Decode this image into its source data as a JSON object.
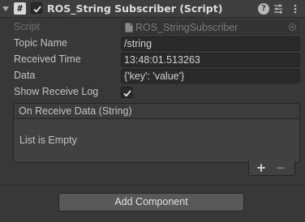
{
  "component": {
    "title": "ROS_String Subscriber (Script)",
    "script_icon_glyph": "#",
    "help_glyph": "?",
    "enabled": true
  },
  "fields": {
    "script": {
      "label": "Script",
      "value": "ROS_StringSubscriber"
    },
    "topic_name": {
      "label": "Topic Name",
      "value": "/string"
    },
    "received_time": {
      "label": "Received Time",
      "value": "13:48:01.513263"
    },
    "data": {
      "label": "Data",
      "value": "{'key': 'value'}"
    },
    "show_receive_log": {
      "label": "Show Receive Log",
      "checked": true
    }
  },
  "event": {
    "title": "On Receive Data (String)",
    "empty_text": "List is Empty",
    "add_glyph": "+",
    "remove_glyph": "−"
  },
  "footer": {
    "add_component_label": "Add Component"
  },
  "icons": {
    "foldout": "foldout-arrow-icon",
    "script": "csharp-script-icon",
    "help": "help-icon",
    "preset": "preset-sliders-icon",
    "menu": "context-menu-icon",
    "file": "script-file-icon",
    "picker": "object-picker-icon",
    "check": "checkmark-icon"
  }
}
